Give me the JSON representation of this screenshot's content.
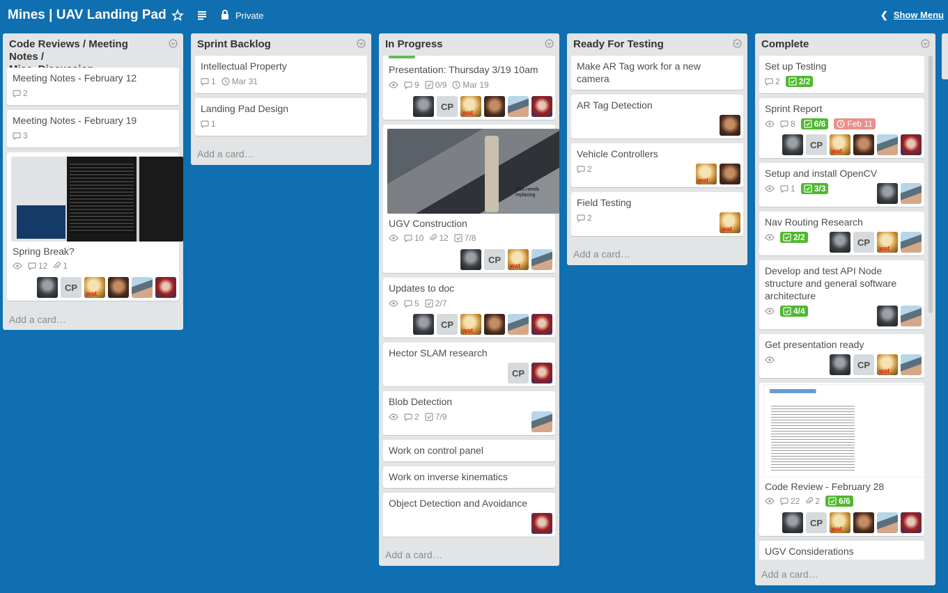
{
  "header": {
    "board_title": "Mines | UAV Landing Pad",
    "visibility_label": "Private",
    "show_menu_label": "Show Menu"
  },
  "lists": [
    {
      "title_line1": "Code Reviews / Meeting Notes /",
      "title_line2": "Misc. Discussion",
      "add_card_label": "Add a card…",
      "cards": [
        {
          "title": "Meeting Notes - February 12",
          "comments": "2"
        },
        {
          "title": "Meeting Notes - February 19",
          "comments": "3"
        },
        {
          "title": "Spring Break?",
          "comments": "12",
          "attachments": "1"
        }
      ]
    },
    {
      "title": "Sprint Backlog",
      "add_card_label": "Add a card…",
      "cards": [
        {
          "title": "Intellectual Property",
          "comments": "1",
          "due": "Mar 31"
        },
        {
          "title": "Landing Pad Design",
          "comments": "1"
        }
      ]
    },
    {
      "title": "In Progress",
      "add_card_label": "Add a card…",
      "cards": [
        {
          "title": "Presentation: Thursday 3/19 10am",
          "comments": "9",
          "checklist": "0/9",
          "due": "Mar 19"
        },
        {
          "title": "UGV Construction",
          "comments": "10",
          "attachments": "12",
          "checklist": "7/8"
        },
        {
          "title": "Updates to doc",
          "comments": "5",
          "checklist": "2/7"
        },
        {
          "title": "Hector SLAM research"
        },
        {
          "title": "Blob Detection",
          "comments": "2",
          "checklist": "7/9"
        },
        {
          "title": "Work on control panel"
        },
        {
          "title": "Work on inverse kinematics"
        },
        {
          "title": "Object Detection and Avoidance"
        }
      ]
    },
    {
      "title": "Ready For Testing",
      "add_card_label": "Add a card…",
      "cards": [
        {
          "title_line1": "Make AR Tag work for a new",
          "title_line2": "camera"
        },
        {
          "title": "AR Tag Detection"
        },
        {
          "title": "Vehicle Controllers",
          "comments": "2"
        },
        {
          "title": "Field Testing",
          "comments": "2"
        }
      ]
    },
    {
      "title": "Complete",
      "add_card_label": "Add a card…",
      "cards": [
        {
          "title": "Set up Testing",
          "comments": "2",
          "checklist": "2/2"
        },
        {
          "title": "Sprint Report",
          "comments": "8",
          "checklist": "6/6",
          "due": "Feb 11"
        },
        {
          "title": "Setup and install OpenCV",
          "comments": "1",
          "checklist": "3/3"
        },
        {
          "title": "Nav Routing Research",
          "checklist": "2/2"
        },
        {
          "title_line1": "Develop and test API Node",
          "title_line2": "structure and general software",
          "title_line3": "architecture",
          "checklist": "4/4"
        },
        {
          "title": "Get presentation ready"
        },
        {
          "title": "Code Review - February 28",
          "comments": "22",
          "attachments": "2",
          "checklist": "6/6"
        },
        {
          "title": "UGV Considerations"
        }
      ]
    }
  ],
  "member_initials": "CP",
  "colors": {
    "board_bg": "#0f6fb0",
    "list_bg": "#e2e4e6",
    "green_badge": "#4fb82f",
    "due_overdue": "#e98f8a",
    "label_green": "#61bd4f"
  }
}
